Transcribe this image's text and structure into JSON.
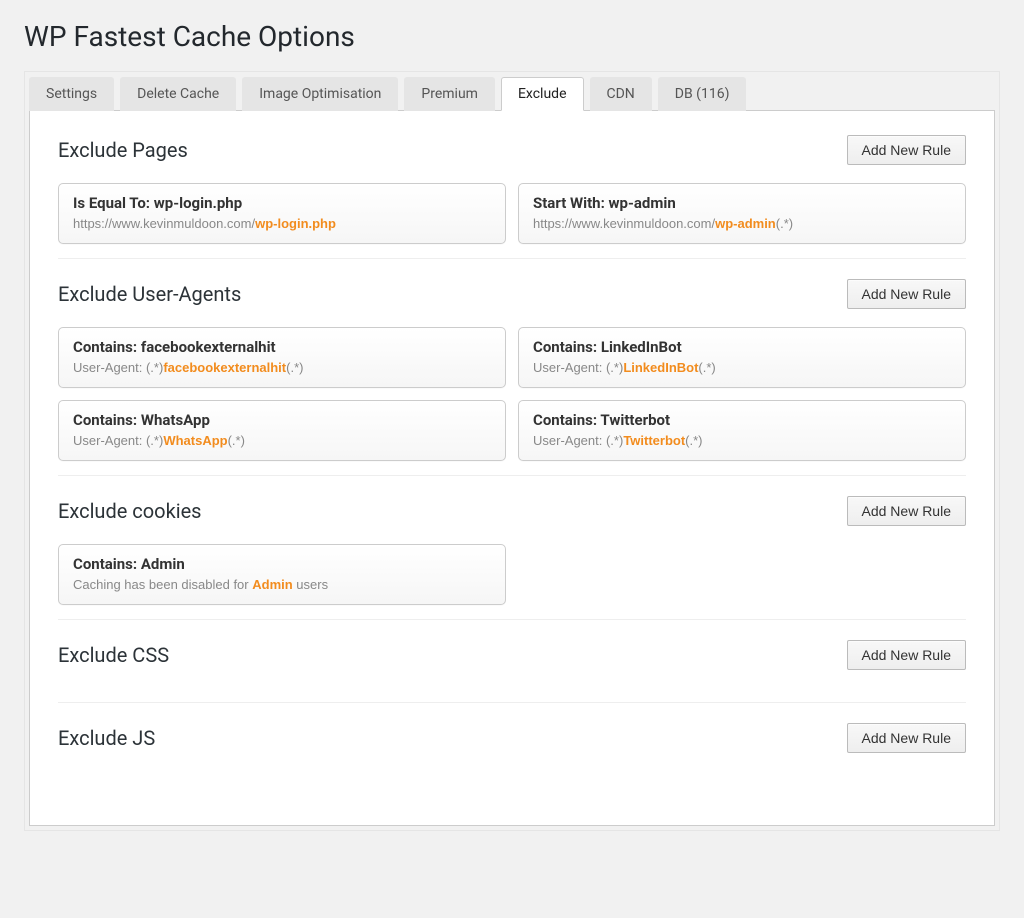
{
  "page_title": "WP Fastest Cache Options",
  "tabs": [
    {
      "label": "Settings",
      "active": false
    },
    {
      "label": "Delete Cache",
      "active": false
    },
    {
      "label": "Image Optimisation",
      "active": false
    },
    {
      "label": "Premium",
      "active": false
    },
    {
      "label": "Exclude",
      "active": true
    },
    {
      "label": "CDN",
      "active": false
    },
    {
      "label": "DB (116)",
      "active": false
    }
  ],
  "add_rule_label": "Add New Rule",
  "sections": [
    {
      "title": "Exclude Pages",
      "rules": [
        {
          "title_prefix": "Is Equal To: ",
          "title_value": "wp-login.php",
          "sub_pre": "https://www.kevinmuldoon.com/",
          "sub_hl": "wp-login.php",
          "sub_post": ""
        },
        {
          "title_prefix": "Start With: ",
          "title_value": "wp-admin",
          "sub_pre": "https://www.kevinmuldoon.com/",
          "sub_hl": "wp-admin",
          "sub_post": "(.*)"
        }
      ]
    },
    {
      "title": "Exclude User-Agents",
      "rules": [
        {
          "title_prefix": "Contains: ",
          "title_value": "facebookexternalhit",
          "sub_pre": "User-Agent: (.*)",
          "sub_hl": "facebookexternalhit",
          "sub_post": "(.*)"
        },
        {
          "title_prefix": "Contains: ",
          "title_value": "LinkedInBot",
          "sub_pre": "User-Agent: (.*)",
          "sub_hl": "LinkedInBot",
          "sub_post": "(.*)"
        },
        {
          "title_prefix": "Contains: ",
          "title_value": "WhatsApp",
          "sub_pre": "User-Agent: (.*)",
          "sub_hl": "WhatsApp",
          "sub_post": "(.*)"
        },
        {
          "title_prefix": "Contains: ",
          "title_value": "Twitterbot",
          "sub_pre": "User-Agent: (.*)",
          "sub_hl": "Twitterbot",
          "sub_post": "(.*)"
        }
      ]
    },
    {
      "title": "Exclude cookies",
      "rules": [
        {
          "title_prefix": "Contains: ",
          "title_value": "Admin",
          "sub_pre": "Caching has been disabled for ",
          "sub_hl": "Admin",
          "sub_post": " users"
        }
      ]
    },
    {
      "title": "Exclude CSS",
      "rules": []
    },
    {
      "title": "Exclude JS",
      "rules": []
    }
  ]
}
